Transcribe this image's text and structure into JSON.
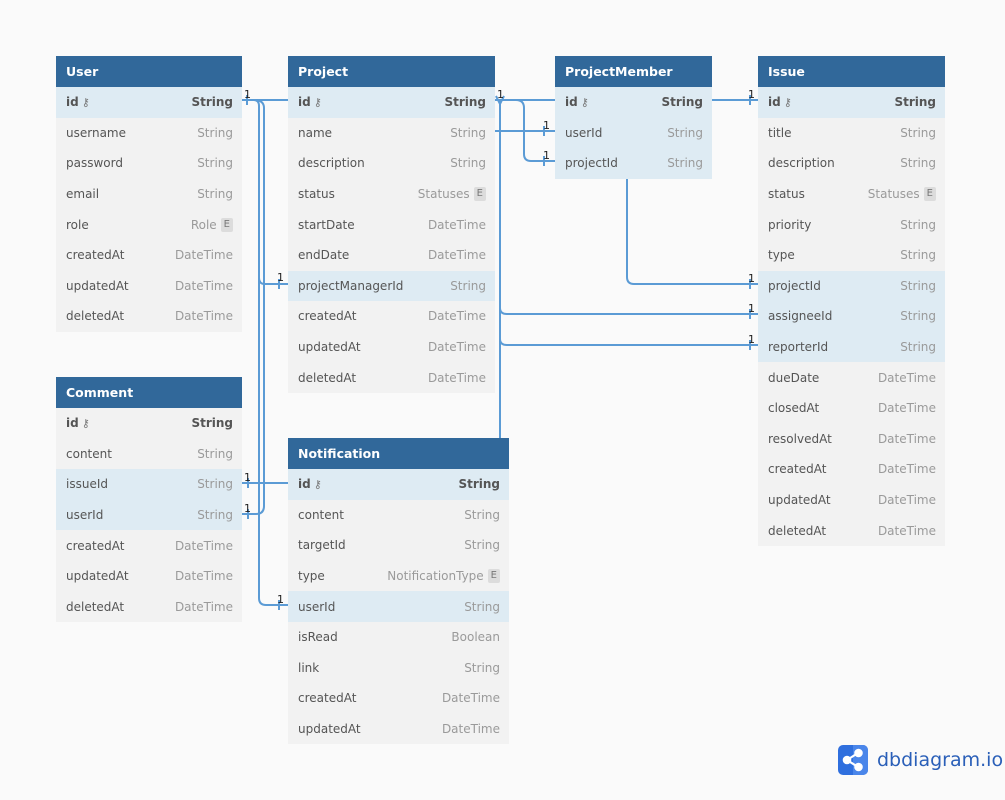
{
  "tables": {
    "user": {
      "name": "User",
      "fields": [
        {
          "name": "id",
          "type": "String",
          "pk": true
        },
        {
          "name": "username",
          "type": "String"
        },
        {
          "name": "password",
          "type": "String"
        },
        {
          "name": "email",
          "type": "String"
        },
        {
          "name": "role",
          "type": "Role",
          "enum": "E"
        },
        {
          "name": "createdAt",
          "type": "DateTime"
        },
        {
          "name": "updatedAt",
          "type": "DateTime"
        },
        {
          "name": "deletedAt",
          "type": "DateTime"
        }
      ]
    },
    "project": {
      "name": "Project",
      "fields": [
        {
          "name": "id",
          "type": "String",
          "pk": true
        },
        {
          "name": "name",
          "type": "String"
        },
        {
          "name": "description",
          "type": "String"
        },
        {
          "name": "status",
          "type": "Statuses",
          "enum": "E"
        },
        {
          "name": "startDate",
          "type": "DateTime"
        },
        {
          "name": "endDate",
          "type": "DateTime"
        },
        {
          "name": "projectManagerId",
          "type": "String"
        },
        {
          "name": "createdAt",
          "type": "DateTime"
        },
        {
          "name": "updatedAt",
          "type": "DateTime"
        },
        {
          "name": "deletedAt",
          "type": "DateTime"
        }
      ]
    },
    "projectMember": {
      "name": "ProjectMember",
      "fields": [
        {
          "name": "id",
          "type": "String",
          "pk": true
        },
        {
          "name": "userId",
          "type": "String"
        },
        {
          "name": "projectId",
          "type": "String"
        }
      ]
    },
    "issue": {
      "name": "Issue",
      "fields": [
        {
          "name": "id",
          "type": "String",
          "pk": true
        },
        {
          "name": "title",
          "type": "String"
        },
        {
          "name": "description",
          "type": "String"
        },
        {
          "name": "status",
          "type": "Statuses",
          "enum": "E"
        },
        {
          "name": "priority",
          "type": "String"
        },
        {
          "name": "type",
          "type": "String"
        },
        {
          "name": "projectId",
          "type": "String"
        },
        {
          "name": "assigneeId",
          "type": "String"
        },
        {
          "name": "reporterId",
          "type": "String"
        },
        {
          "name": "dueDate",
          "type": "DateTime"
        },
        {
          "name": "closedAt",
          "type": "DateTime"
        },
        {
          "name": "resolvedAt",
          "type": "DateTime"
        },
        {
          "name": "createdAt",
          "type": "DateTime"
        },
        {
          "name": "updatedAt",
          "type": "DateTime"
        },
        {
          "name": "deletedAt",
          "type": "DateTime"
        }
      ]
    },
    "comment": {
      "name": "Comment",
      "fields": [
        {
          "name": "id",
          "type": "String",
          "pk": true
        },
        {
          "name": "content",
          "type": "String"
        },
        {
          "name": "issueId",
          "type": "String"
        },
        {
          "name": "userId",
          "type": "String"
        },
        {
          "name": "createdAt",
          "type": "DateTime"
        },
        {
          "name": "updatedAt",
          "type": "DateTime"
        },
        {
          "name": "deletedAt",
          "type": "DateTime"
        }
      ]
    },
    "notification": {
      "name": "Notification",
      "fields": [
        {
          "name": "id",
          "type": "String",
          "pk": true
        },
        {
          "name": "content",
          "type": "String"
        },
        {
          "name": "targetId",
          "type": "String"
        },
        {
          "name": "type",
          "type": "NotificationType",
          "enum": "E"
        },
        {
          "name": "userId",
          "type": "String"
        },
        {
          "name": "isRead",
          "type": "Boolean"
        },
        {
          "name": "link",
          "type": "String"
        },
        {
          "name": "createdAt",
          "type": "DateTime"
        },
        {
          "name": "updatedAt",
          "type": "DateTime"
        }
      ]
    }
  },
  "relationships": [
    {
      "from": "User.id",
      "to": "Project.projectManagerId",
      "label": "1"
    },
    {
      "from": "User.id",
      "to": "Comment.userId",
      "label": "1"
    },
    {
      "from": "User.id",
      "to": "Notification.userId",
      "label": "1"
    },
    {
      "from": "User.id",
      "to": "ProjectMember.userId",
      "label": "1"
    },
    {
      "from": "User.id",
      "to": "Issue.assigneeId",
      "label": "1"
    },
    {
      "from": "User.id",
      "to": "Issue.reporterId",
      "label": "1"
    },
    {
      "from": "Project.id",
      "to": "ProjectMember.projectId",
      "label": "1"
    },
    {
      "from": "Project.id",
      "to": "Issue.projectId",
      "label": "1"
    },
    {
      "from": "ProjectMember.id",
      "to": "Issue.id",
      "label": "1"
    },
    {
      "from": "Issue.id",
      "to": "Comment.issueId",
      "label": "1"
    }
  ],
  "colors": {
    "header": "#31689a",
    "highlight": "#deebf3",
    "row": "#f2f2f2",
    "link": "#5b9bd5"
  },
  "brand": {
    "name": "dbdiagram.io",
    "icon": "share-nodes-icon"
  },
  "highlighted": {
    "user": [
      "id"
    ],
    "project": [
      "id",
      "projectManagerId"
    ],
    "projectMember": [
      "id",
      "userId",
      "projectId"
    ],
    "issue": [
      "id",
      "projectId",
      "assigneeId",
      "reporterId"
    ],
    "comment": [
      "issueId",
      "userId"
    ],
    "notification": [
      "id",
      "userId"
    ]
  }
}
